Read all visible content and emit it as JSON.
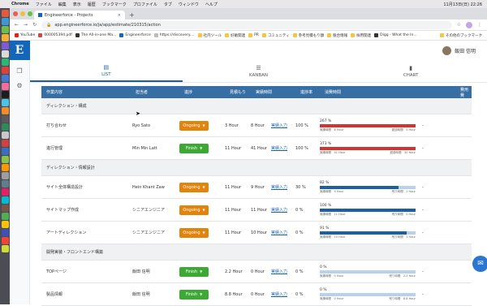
{
  "mac_menu": {
    "app": "Chrome",
    "items": [
      "ファイル",
      "編集",
      "表示",
      "履歴",
      "ブックマーク",
      "プロファイル",
      "タブ",
      "ウィンドウ",
      "ヘルプ"
    ],
    "clock": "11月13日(日) 22:26"
  },
  "browser": {
    "tab_title": "Engineerforce - Projects",
    "url": "app.engineerforce.io/ja/app/estimate/210315/action",
    "bookmarks": [
      "YouTube",
      "000005394.pdf",
      "The All-in-one Ma...",
      "Engineerforce",
      "https://discovery....",
      "社内ツール",
      "好敵関連",
      "PR",
      "コミュニティ",
      "参考見積もり額",
      "競合情報",
      "採用関連",
      "Digg - What the In..."
    ],
    "bookmarks_right": "その他のブックマーク"
  },
  "app": {
    "logo": "E",
    "user_name": "飯田 信明"
  },
  "view_tabs": [
    {
      "icon": "▤",
      "label": "LIST"
    },
    {
      "icon": "☰",
      "label": "KANBAN"
    },
    {
      "icon": "▮",
      "label": "CHART"
    }
  ],
  "table": {
    "headers": [
      "作業内容",
      "担当者",
      "進捗",
      "見積もり",
      "実績時間",
      "進捗率",
      "消費時間",
      "費用費"
    ],
    "groups": [
      {
        "title": "ディレクション・構成",
        "rows": [
          {
            "task": "打ち合わせ",
            "assignee": "Ryo Sato",
            "status": "Ongoing",
            "estimate": "3 Hour",
            "actual": "8 Hour",
            "link": "実績入力",
            "rate": "100 %",
            "consume_pct": "267 %",
            "consume_left": "実績時間　8 Hour",
            "consume_right": "超過時間　5 Hour",
            "cost": "-"
          },
          {
            "task": "進行管理",
            "assignee": "Min Min Latt",
            "status": "Finish",
            "estimate": "11 Hour",
            "actual": "41 Hour",
            "link": "実績入力",
            "rate": "100 %",
            "consume_pct": "373 %",
            "consume_left": "実績時間　41 Hour",
            "consume_right": "超過時間　30 Hour",
            "cost": "-"
          }
        ]
      },
      {
        "title": "ディレクション・情報設計",
        "rows": [
          {
            "task": "サイト全体構造設計",
            "assignee": "Hein Khant Zaw",
            "status": "Ongoing",
            "estimate": "11 Hour",
            "actual": "9 Hour",
            "link": "実績入力",
            "rate": "30 %",
            "consume_pct": "82 %",
            "consume_left": "実績時間　9 Hour",
            "consume_right": "残り時間　2 Hour",
            "cost": "-"
          },
          {
            "task": "サイトマップ作成",
            "assignee": "シニアエンジニア",
            "status": "Ongoing",
            "estimate": "11 Hour",
            "actual": "11 Hour",
            "link": "実績入力",
            "rate": "0 %",
            "consume_pct": "100 %",
            "consume_left": "実績時間　11 Hour",
            "consume_right": "残り時間　0 Hour",
            "cost": "-"
          },
          {
            "task": "アートディレクション",
            "assignee": "シニアエンジニア",
            "status": "Ongoing",
            "estimate": "11 Hour",
            "actual": "10 Hour",
            "link": "実績入力",
            "rate": "0 %",
            "consume_pct": "91 %",
            "consume_left": "実績時間　10 Hour",
            "consume_right": "残り時間　1 Hour",
            "cost": "-"
          }
        ]
      },
      {
        "title": "開発実装・フロントエンド構築",
        "rows": [
          {
            "task": "TOPページ",
            "assignee": "飯田 信明",
            "status": "Finish",
            "estimate": "2.2 Hour",
            "actual": "0 Hour",
            "link": "実績入力",
            "rate": "0 %",
            "consume_pct": "0 %",
            "consume_left": "実績時間　0 Hour",
            "consume_right": "残り時間　2.2 Hour",
            "cost": "-"
          },
          {
            "task": "製品情報",
            "assignee": "飯田 信明",
            "status": "Finish",
            "estimate": "8.8 Hour",
            "actual": "0 Hour",
            "link": "実績入力",
            "rate": "0 %",
            "consume_pct": "0 %",
            "consume_left": "実績時間　0 Hour",
            "consume_right": "残り時間　8.8 Hour",
            "cost": "-"
          }
        ]
      }
    ]
  },
  "colors": {
    "header": "#376ea3",
    "ongoing": "#e2830c",
    "finish": "#3da935",
    "over": "#d23530",
    "normal": "#1e5fa3"
  }
}
